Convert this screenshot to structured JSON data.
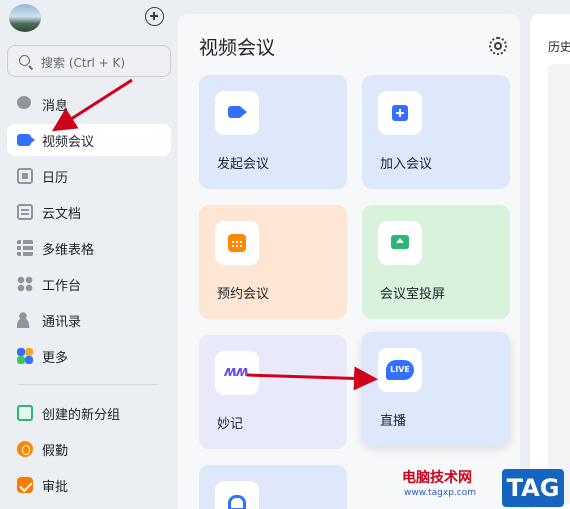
{
  "sidebar": {
    "search_placeholder": "搜索 (Ctrl + K)",
    "items": [
      {
        "label": "消息",
        "icon": "chat-bubble-icon"
      },
      {
        "label": "视频会议",
        "icon": "video-camera-icon"
      },
      {
        "label": "日历",
        "icon": "calendar-icon"
      },
      {
        "label": "云文档",
        "icon": "document-icon"
      },
      {
        "label": "多维表格",
        "icon": "table-icon"
      },
      {
        "label": "工作台",
        "icon": "workplace-icon"
      },
      {
        "label": "通讯录",
        "icon": "contacts-icon"
      },
      {
        "label": "更多",
        "icon": "more-apps-icon"
      }
    ],
    "apps": [
      {
        "label": "创建的新分组",
        "icon": "group-icon"
      },
      {
        "label": "假勤",
        "icon": "leave-icon"
      },
      {
        "label": "审批",
        "icon": "approval-icon"
      }
    ]
  },
  "main": {
    "title": "视频会议",
    "cards": [
      {
        "label": "发起会议",
        "icon": "video-camera-icon",
        "color": "#dfe7fb"
      },
      {
        "label": "加入会议",
        "icon": "plus-square-icon",
        "color": "#dfe7fb"
      },
      {
        "label": "预约会议",
        "icon": "calendar-icon",
        "color": "#fde6d3"
      },
      {
        "label": "会议室投屏",
        "icon": "screen-cast-icon",
        "color": "#d8f2dd"
      },
      {
        "label": "妙记",
        "icon": "minutes-icon",
        "color": "#e8e9fb"
      },
      {
        "label": "直播",
        "icon": "live-icon",
        "color": "#dfe7fb"
      }
    ],
    "live_badge": "LIVE"
  },
  "right_panel": {
    "title": "历史"
  },
  "watermark": {
    "site_name": "电脑技术网",
    "url": "www.tagxp.com",
    "tag": "TAG"
  },
  "colors": {
    "accent": "#3370ff",
    "annotation_arrow": "#d0021b"
  }
}
